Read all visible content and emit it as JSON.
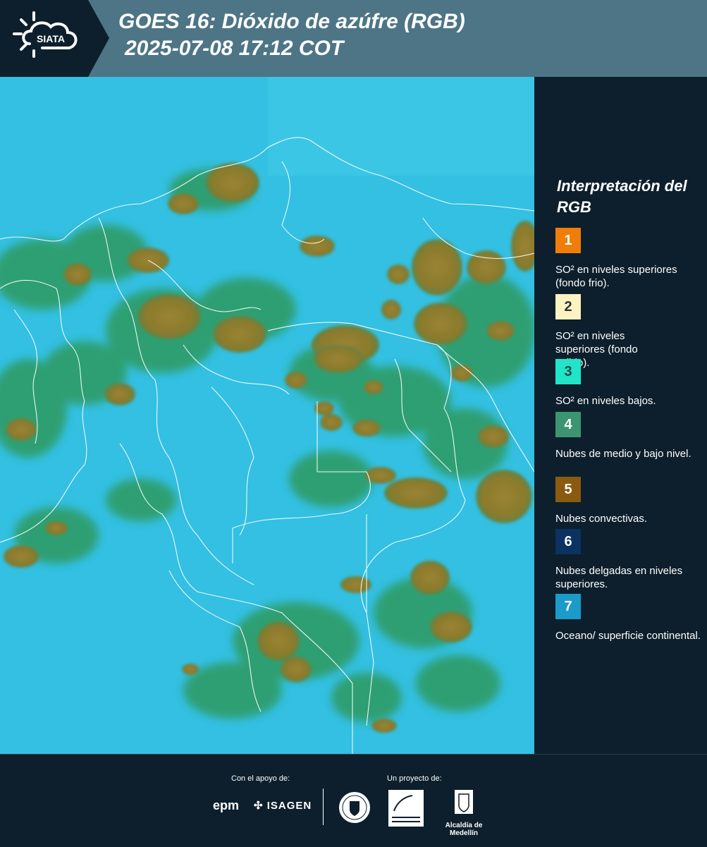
{
  "header": {
    "logo_text": "SIATA",
    "title_line1": "GOES 16: Dióxido de azúfre (RGB)",
    "title_line2": "2025-07-08 17:12 COT"
  },
  "legend": {
    "title": "Interpretación del RGB",
    "items": [
      {
        "number": "1",
        "label": "SO² en niveles superiores (fondo frio).",
        "color": "#f07d0a",
        "text_color": "#1a1a1a"
      },
      {
        "number": "2",
        "label": "SO² en niveles superiores (fondo calido).",
        "color": "#fbf3c2",
        "text_color": "#333333"
      },
      {
        "number": "3",
        "label": "SO² en niveles bajos.",
        "color": "#20e5c8",
        "text_color": "#1a4a44"
      },
      {
        "number": "4",
        "label": "Nubes de medio y bajo nivel.",
        "color": "#3c9570",
        "text_color": "#ffffff"
      },
      {
        "number": "5",
        "label": "Nubes convectivas.",
        "color": "#8a5a10",
        "text_color": "#ffffff"
      },
      {
        "number": "6",
        "label": "Nubes delgadas en niveles superiores.",
        "color": "#0c3262",
        "text_color": "#ffffff"
      },
      {
        "number": "7",
        "label": "Oceano/ superficie continental.",
        "color": "#1b9bc8",
        "text_color": "#ffffff"
      }
    ]
  },
  "footer": {
    "support_label": "Con el apoyo de:",
    "project_label": "Un proyecto de:",
    "sponsor_1": "epm",
    "sponsor_2": "ISAGEN",
    "partner_3": "Alcaldía de Medellín"
  },
  "colors": {
    "header_bg": "#4d7585",
    "logo_bg": "#0d1f2c",
    "ocean": "#33c0e2",
    "cloud_green": "#2f9a5e",
    "convective": "#8d7a30"
  }
}
